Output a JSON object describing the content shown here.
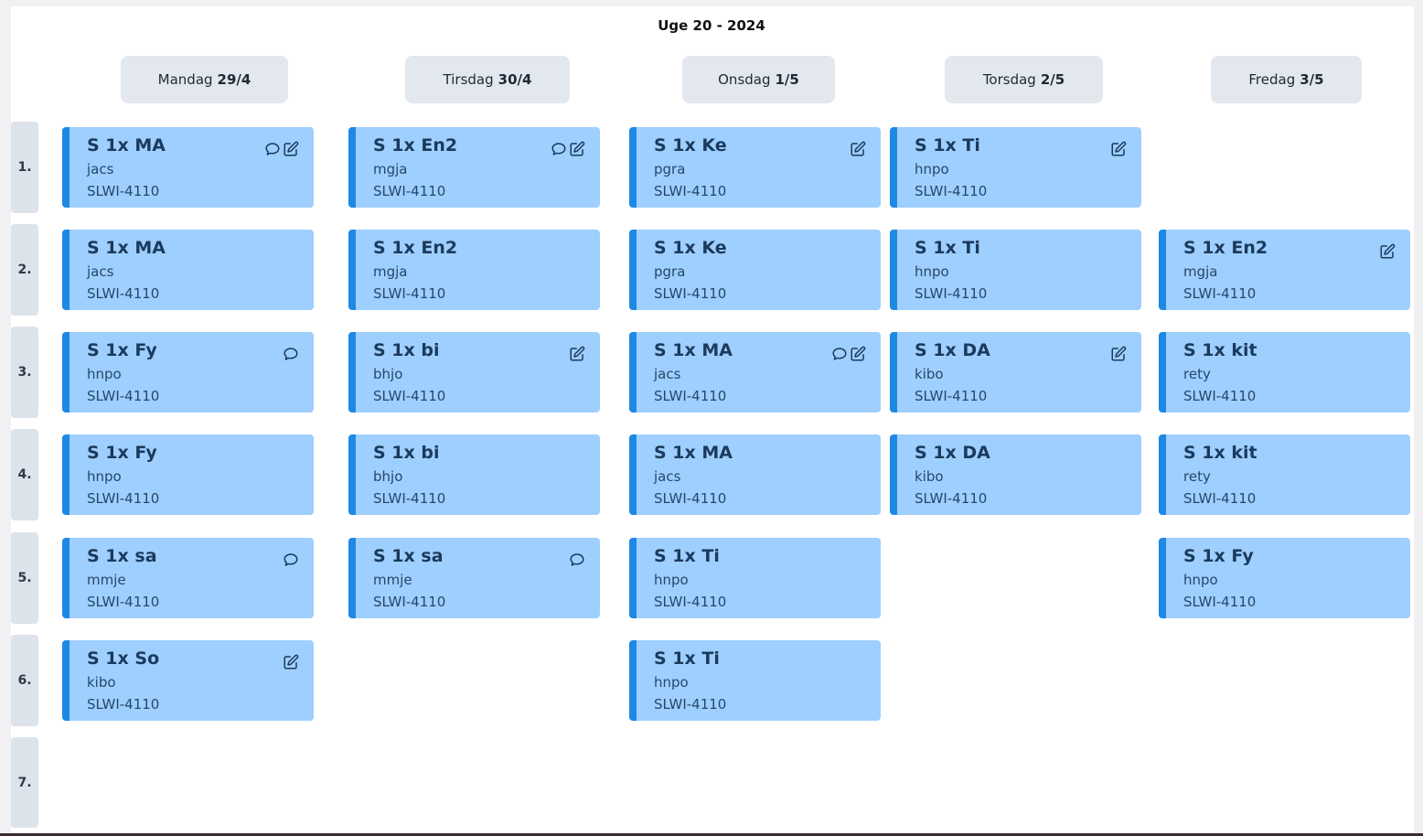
{
  "week_title": "Uge 20 - 2024",
  "colors": {
    "card": "#9ecfff",
    "card_accent": "#1e88e5",
    "header_bg": "#e3e8ee",
    "period_bg": "#dde3ea"
  },
  "days": [
    {
      "name": "Mandag",
      "date": "29/4"
    },
    {
      "name": "Tirsdag",
      "date": "30/4"
    },
    {
      "name": "Onsdag",
      "date": "1/5"
    },
    {
      "name": "Torsdag",
      "date": "2/5"
    },
    {
      "name": "Fredag",
      "date": "3/5"
    }
  ],
  "periods": [
    "1.",
    "2.",
    "3.",
    "4.",
    "5.",
    "6.",
    "7."
  ],
  "lessons": [
    {
      "day": 0,
      "period": 0,
      "subject": "S 1x MA",
      "teacher": "jacs",
      "room": "SLWI-4110",
      "icons": [
        "comment-icon",
        "edit-icon"
      ]
    },
    {
      "day": 0,
      "period": 1,
      "subject": "S 1x MA",
      "teacher": "jacs",
      "room": "SLWI-4110",
      "icons": []
    },
    {
      "day": 0,
      "period": 2,
      "subject": "S 1x Fy",
      "teacher": "hnpo",
      "room": "SLWI-4110",
      "icons": [
        "comment-icon"
      ]
    },
    {
      "day": 0,
      "period": 3,
      "subject": "S 1x Fy",
      "teacher": "hnpo",
      "room": "SLWI-4110",
      "icons": []
    },
    {
      "day": 0,
      "period": 4,
      "subject": "S 1x sa",
      "teacher": "mmje",
      "room": "SLWI-4110",
      "icons": [
        "comment-icon"
      ]
    },
    {
      "day": 0,
      "period": 5,
      "subject": "S 1x So",
      "teacher": "kibo",
      "room": "SLWI-4110",
      "icons": [
        "edit-icon"
      ]
    },
    {
      "day": 1,
      "period": 0,
      "subject": "S 1x En2",
      "teacher": "mgja",
      "room": "SLWI-4110",
      "icons": [
        "comment-icon",
        "edit-icon"
      ]
    },
    {
      "day": 1,
      "period": 1,
      "subject": "S 1x En2",
      "teacher": "mgja",
      "room": "SLWI-4110",
      "icons": []
    },
    {
      "day": 1,
      "period": 2,
      "subject": "S 1x bi",
      "teacher": "bhjo",
      "room": "SLWI-4110",
      "icons": [
        "edit-icon"
      ]
    },
    {
      "day": 1,
      "period": 3,
      "subject": "S 1x bi",
      "teacher": "bhjo",
      "room": "SLWI-4110",
      "icons": []
    },
    {
      "day": 1,
      "period": 4,
      "subject": "S 1x sa",
      "teacher": "mmje",
      "room": "SLWI-4110",
      "icons": [
        "comment-icon"
      ]
    },
    {
      "day": 2,
      "period": 0,
      "subject": "S 1x Ke",
      "teacher": "pgra",
      "room": "SLWI-4110",
      "icons": [
        "edit-icon"
      ]
    },
    {
      "day": 2,
      "period": 1,
      "subject": "S 1x Ke",
      "teacher": "pgra",
      "room": "SLWI-4110",
      "icons": []
    },
    {
      "day": 2,
      "period": 2,
      "subject": "S 1x MA",
      "teacher": "jacs",
      "room": "SLWI-4110",
      "icons": [
        "comment-icon",
        "edit-icon"
      ]
    },
    {
      "day": 2,
      "period": 3,
      "subject": "S 1x MA",
      "teacher": "jacs",
      "room": "SLWI-4110",
      "icons": []
    },
    {
      "day": 2,
      "period": 4,
      "subject": "S 1x Ti",
      "teacher": "hnpo",
      "room": "SLWI-4110",
      "icons": []
    },
    {
      "day": 2,
      "period": 5,
      "subject": "S 1x Ti",
      "teacher": "hnpo",
      "room": "SLWI-4110",
      "icons": []
    },
    {
      "day": 3,
      "period": 0,
      "subject": "S 1x Ti",
      "teacher": "hnpo",
      "room": "SLWI-4110",
      "icons": [
        "edit-icon"
      ]
    },
    {
      "day": 3,
      "period": 1,
      "subject": "S 1x Ti",
      "teacher": "hnpo",
      "room": "SLWI-4110",
      "icons": []
    },
    {
      "day": 3,
      "period": 2,
      "subject": "S 1x DA",
      "teacher": "kibo",
      "room": "SLWI-4110",
      "icons": [
        "edit-icon"
      ]
    },
    {
      "day": 3,
      "period": 3,
      "subject": "S 1x DA",
      "teacher": "kibo",
      "room": "SLWI-4110",
      "icons": []
    },
    {
      "day": 4,
      "period": 1,
      "subject": "S 1x En2",
      "teacher": "mgja",
      "room": "SLWI-4110",
      "icons": [
        "edit-icon"
      ]
    },
    {
      "day": 4,
      "period": 2,
      "subject": "S 1x kit",
      "teacher": "rety",
      "room": "SLWI-4110",
      "icons": []
    },
    {
      "day": 4,
      "period": 3,
      "subject": "S 1x kit",
      "teacher": "rety",
      "room": "SLWI-4110",
      "icons": []
    },
    {
      "day": 4,
      "period": 4,
      "subject": "S 1x Fy",
      "teacher": "hnpo",
      "room": "SLWI-4110",
      "icons": []
    }
  ]
}
